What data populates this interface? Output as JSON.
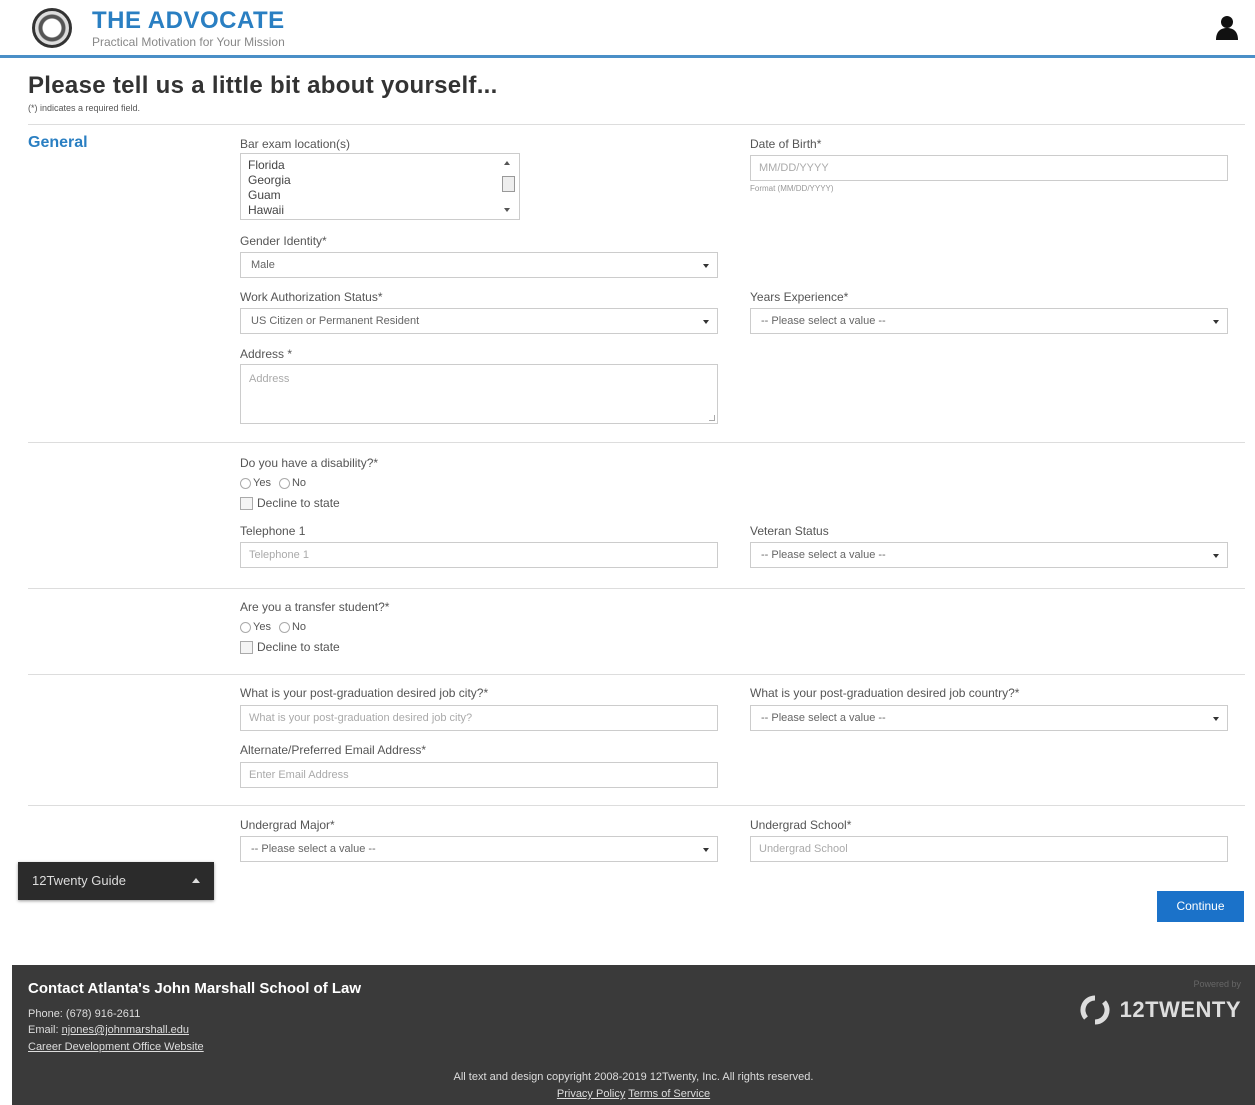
{
  "header": {
    "brand_title": "THE ADVOCATE",
    "brand_subtitle": "Practical Motivation for Your Mission",
    "user_icon": "user-icon"
  },
  "page": {
    "title": "Please tell us a little bit about yourself...",
    "required_note": "(*) indicates a required field.",
    "section_general": "General"
  },
  "form": {
    "bar_exam": {
      "label": "Bar exam location(s)",
      "options": [
        "Florida",
        "Georgia",
        "Guam",
        "Hawaii"
      ]
    },
    "dob": {
      "label": "Date of Birth*",
      "placeholder": "MM/DD/YYYY",
      "hint": "Format (MM/DD/YYYY)"
    },
    "gender": {
      "label": "Gender Identity*",
      "value": "Male"
    },
    "work_auth": {
      "label": "Work Authorization Status*",
      "value": "US Citizen or Permanent Resident"
    },
    "years_exp": {
      "label": "Years Experience*",
      "value": "-- Please select a value --"
    },
    "address": {
      "label": "Address *",
      "placeholder": "Address"
    },
    "disability": {
      "label": "Do you have a disability?*",
      "yes": "Yes",
      "no": "No",
      "decline": "Decline to state"
    },
    "telephone": {
      "label": "Telephone 1",
      "placeholder": "Telephone 1"
    },
    "veteran": {
      "label": "Veteran Status",
      "value": "-- Please select a value --"
    },
    "transfer": {
      "label": "Are you a transfer student?*",
      "yes": "Yes",
      "no": "No",
      "decline": "Decline to state"
    },
    "job_city": {
      "label": "What is your post-graduation desired job city?*",
      "placeholder": "What is your post-graduation desired job city?"
    },
    "job_country": {
      "label": "What is your post-graduation desired job country?*",
      "value": "-- Please select a value --"
    },
    "alt_email": {
      "label": "Alternate/Preferred Email Address*",
      "placeholder": "Enter Email Address"
    },
    "major": {
      "label": "Undergrad Major*",
      "value": "-- Please select a value --"
    },
    "school": {
      "label": "Undergrad School*",
      "placeholder": "Undergrad School"
    }
  },
  "guide": {
    "label": "12Twenty Guide"
  },
  "continue_label": "Continue",
  "footer": {
    "title": "Contact Atlanta's John Marshall School of Law",
    "phone": "Phone: (678) 916-2611",
    "email_label": "Email: ",
    "email": "njones@johnmarshall.edu",
    "website": "Career Development Office Website",
    "copyright": "All text and design copyright 2008-2019 12Twenty, Inc. All rights reserved.",
    "privacy": "Privacy Policy",
    "terms": "Terms of Service",
    "powered_by": "Powered by",
    "logo_text": "12TWENTY"
  }
}
